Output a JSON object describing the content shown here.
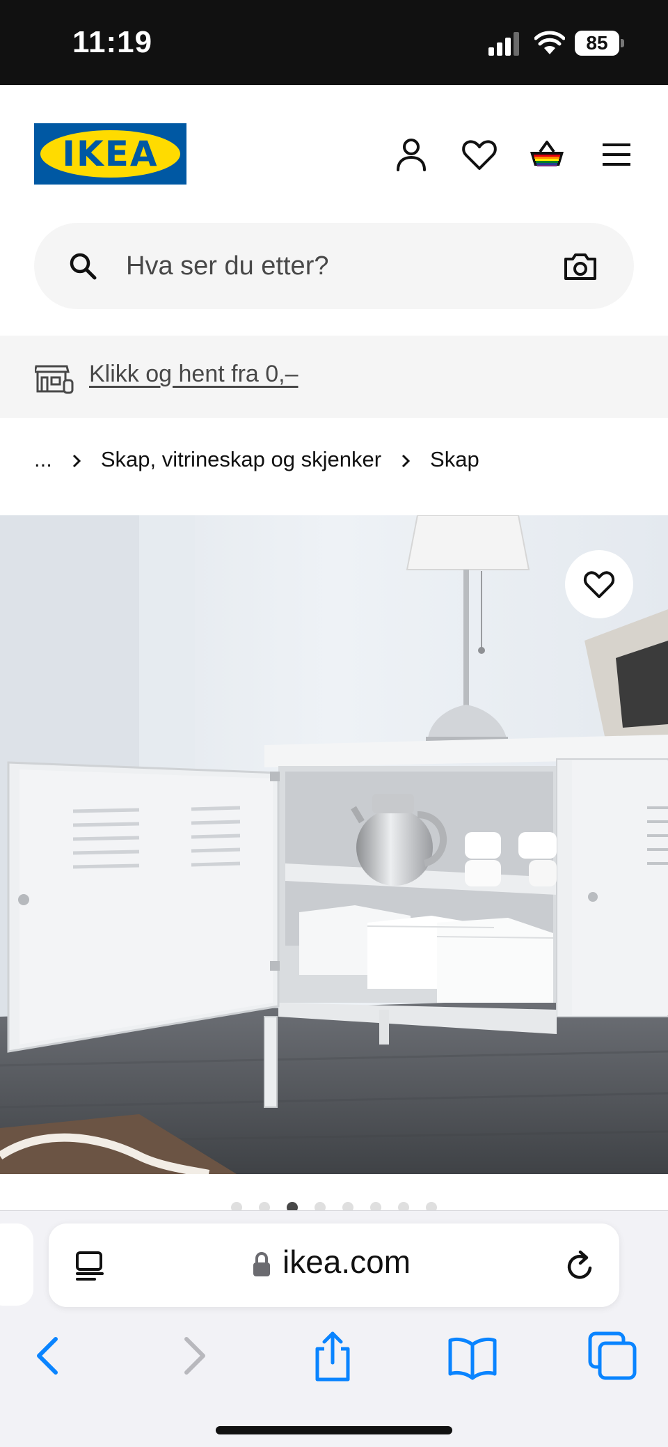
{
  "status_bar": {
    "time": "11:19",
    "battery": "85"
  },
  "header": {
    "logo_text": "IKEA",
    "icons": [
      "account-icon",
      "heart-icon",
      "cart-icon",
      "menu-icon"
    ]
  },
  "search": {
    "placeholder": "Hva ser du etter?"
  },
  "promo": {
    "text": "Klikk og hent fra 0,–"
  },
  "breadcrumb": {
    "items": [
      "...",
      "Skap, vitrineskap og skjenker",
      "Skap"
    ]
  },
  "gallery": {
    "image_alt": "Hvitt metallskap med åpen dør, tekanne, kopper og bokser på hylle",
    "total_images": 8,
    "active_index": 2
  },
  "browser": {
    "url": "ikea.com"
  },
  "colors": {
    "ikea_blue": "#0058a3",
    "ikea_yellow": "#ffdb00",
    "safari_blue": "#0a84ff"
  }
}
